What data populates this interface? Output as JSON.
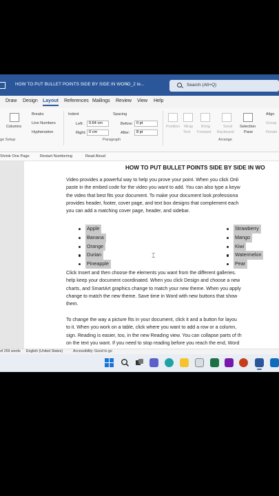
{
  "titlebar": {
    "doc_title": "HOW TO PUT BULLET POINTS SIDE BY SIDE IN WORD_2 te...",
    "chevron": "⌄",
    "search_placeholder": "Search (Alt+Q)"
  },
  "tabs": [
    "Draw",
    "Design",
    "Layout",
    "References",
    "Mailings",
    "Review",
    "View",
    "Help"
  ],
  "active_tab": "Layout",
  "ribbon": {
    "breaks": "Breaks",
    "columns": "Columns",
    "line_numbers": "Line Numbers",
    "hyphenation": "Hyphenation",
    "page_setup": "ge Setup",
    "indent": "Indent",
    "indent_left_label": "Left:",
    "indent_left_value": "0.64 cm",
    "indent_right_label": "Right:",
    "indent_right_value": "0 cm",
    "spacing": "Spacing",
    "before_label": "Before:",
    "before_value": "0 pt",
    "after_label": "After:",
    "after_value": "8 pt",
    "paragraph": "Paragraph",
    "position": "Position",
    "wrap_text_1": "Wrap",
    "wrap_text_2": "Text",
    "bring_forward_1": "Bring",
    "bring_forward_2": "Forward",
    "send_backward_1": "Send",
    "send_backward_2": "Backward",
    "selection_pane_1": "Selection",
    "selection_pane_2": "Pane",
    "align": "Align",
    "group": "Group",
    "rotate": "Rotate",
    "arrange": "Arrange"
  },
  "quickbar": {
    "shrink": "Shrink One Page",
    "restart": "Restart Numbering",
    "read_aloud": "Read Aloud"
  },
  "document": {
    "heading": "HOW TO PUT BULLET POINTS SIDE BY SIDE IN WO",
    "para1": [
      "Video provides a powerful way to help you prove your point. When you click Onli",
      "paste in the embed code for the video you want to add. You can also type a keyw",
      "the video that best fits your document. To make your document look professiona",
      "provides header, footer, cover page, and text box designs that complement each",
      "you can add a matching cover page, header, and sidebar."
    ],
    "left_list": [
      "Apple",
      "Banana",
      "Orange",
      "Durian",
      "Pineapple"
    ],
    "right_list": [
      "Strawberry",
      "Mango",
      "Kiwi",
      "Watermelon",
      "Pear"
    ],
    "para2": [
      "Click Insert and then choose the elements you want from the different galleries.",
      "help keep your document coordinated. When you click Design and choose a new",
      "charts, and SmartArt graphics change to match your new theme. When you apply",
      "change to match the new theme. Save time in Word with new buttons that show",
      "them."
    ],
    "para3": [
      "To change the way a picture fits in your document, click it and a button for layou",
      "to it. When you work on a table, click where you want to add a row or a column,",
      "sign. Reading is easier, too, in the new Reading view. You can collapse parts of th",
      "on the text you want. If you need to stop reading before you reach the end, Word"
    ]
  },
  "status": {
    "words": "of 259 words",
    "language": "English (United States)",
    "accessibility": "Accessibility: Good to go"
  },
  "taskbar": {
    "apps": [
      "windows-start",
      "search",
      "task-view",
      "teams",
      "edge",
      "file-explorer",
      "store",
      "excel",
      "onenote",
      "powerpoint",
      "word",
      "outlook"
    ]
  }
}
